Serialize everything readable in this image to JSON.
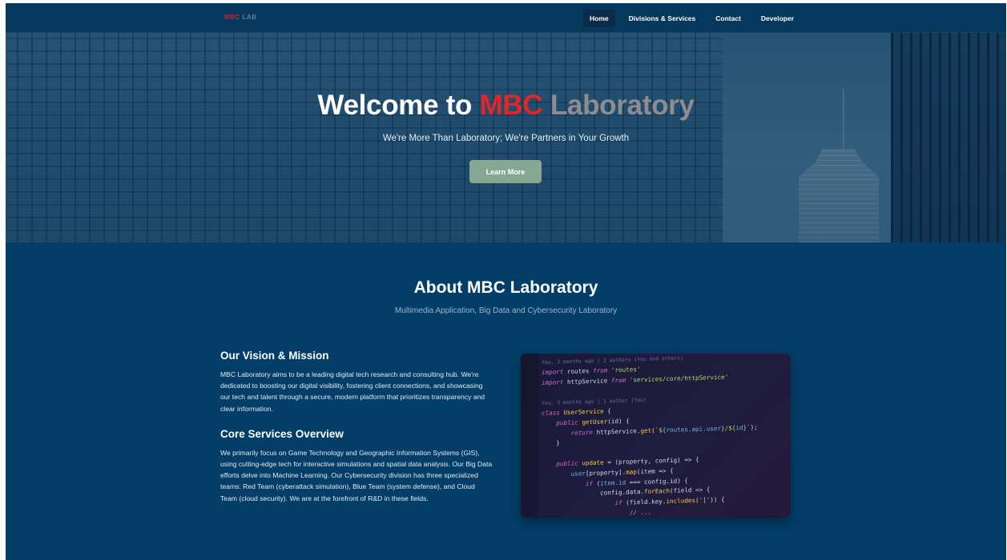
{
  "nav": {
    "logo": "MBC LAB",
    "links": [
      "Home",
      "Divisions & Services",
      "Contact",
      "Developer"
    ],
    "active": "Home"
  },
  "hero": {
    "title_part1": "Welcome to",
    "title_part2": "MBC",
    "title_part3": "Laboratory",
    "subtitle": "We're More Than Laboratory; We're Partners in Your Growth",
    "cta_label": "Learn More"
  },
  "about": {
    "title": "About MBC Laboratory",
    "subtitle": "Multimedia Application, Big Data and Cybersecurity Laboratory",
    "vision_title": "Our Vision & Mission",
    "vision_text": "MBC Laboratory aims to be a leading digital tech research and consulting hub. We're dedicated to boosting our digital visibility, fostering client connections, and showcasing our tech and talent through a secure, modern platform that prioritizes transparency and clear information.",
    "services_title": "Core Services Overview",
    "services_text": "We primarily focus on Game Technology and Geographic Information Systems (GIS), using cutting-edge tech for interactive simulations and spatial data analysis. Our Big Data efforts delve into Machine Learning. Our Cybersecurity division has three specialized teams: Red Team (cyberattack simulation), Blue Team (system defense), and Cloud Team (cloud security). We are at the forefront of R&D in these fields."
  },
  "colors": {
    "page_bg": "#023e68",
    "accent_red": "#e42528",
    "button_green": "#86a791"
  },
  "code_image": {
    "lines": [
      "You, 3 months ago | 2 authors (You and others)",
      "import routes from 'routes'",
      "import httpService from 'services/core/httpService'",
      "",
      "You, 3 months ago | 1 author (You)",
      "class UserService {",
      "    public getUser(id) {",
      "        return httpService.get(`${routes.api.user}/${id}`);",
      "    }",
      "",
      "    public update = (property, config) => {",
      "        user[property].map(item => {",
      "            if (item.id === config.id) {",
      "                config.data.forEach(field => {",
      "                    if (field.key.includes('[')) {",
      "                        // ..."
    ]
  }
}
